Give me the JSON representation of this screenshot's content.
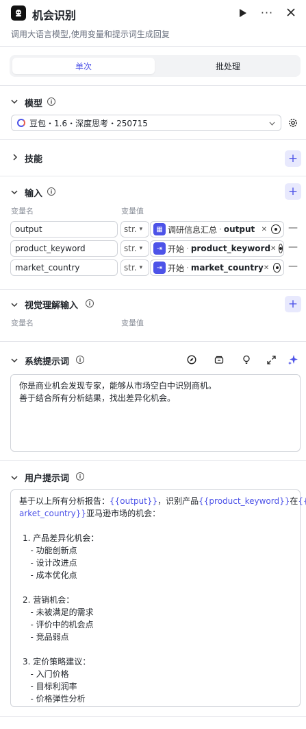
{
  "header": {
    "title": "机会识别",
    "subtitle": "调用大语言模型,使用变量和提示词生成回复",
    "run_icon": "play-icon",
    "more_icon": "more-icon",
    "close_icon": "close-icon"
  },
  "tabs": {
    "single": "单次",
    "batch": "批处理"
  },
  "model": {
    "section_label": "模型",
    "value": "豆包・1.6・深度思考・250715"
  },
  "skills": {
    "section_label": "技能"
  },
  "inputs": {
    "section_label": "输入",
    "col_name": "变量名",
    "col_value": "变量值",
    "rows": [
      {
        "name": "output",
        "type": "str.",
        "node": "调研信息汇总",
        "var": "output"
      },
      {
        "name": "product_keyword",
        "type": "str.",
        "node": "开始",
        "var": "product_keyword"
      },
      {
        "name": "market_country",
        "type": "str.",
        "node": "开始",
        "var": "market_country"
      }
    ]
  },
  "visual": {
    "section_label": "视觉理解输入",
    "col_name": "变量名",
    "col_value": "变量值"
  },
  "system_prompt": {
    "section_label": "系统提示词",
    "line1": "你是商业机会发现专家，能够从市场空白中识别商机。",
    "line2": "善于结合所有分析结果，找出差异化机会。"
  },
  "user_prompt": {
    "section_label": "用户提示词",
    "l1a": "基于以上所有分析报告：",
    "l1b": "{{output}}",
    "l1c": "，识别产品",
    "l1d": "{{product_keyword}}",
    "l1e": "在",
    "l1f": "{{m",
    "l2a": "arket_country}}",
    "l2b": "亚马逊市场的机会：",
    "body": "1. 产品差异化机会：\n   - 功能创新点\n   - 设计改进点\n   - 成本优化点\n\n2. 营销机会：\n   - 未被满足的需求\n   - 评价中的机会点\n   - 竞品弱点\n\n3. 定价策略建议：\n   - 入门价格\n   - 目标利润率\n   - 价格弹性分析"
  },
  "colors": {
    "accent": "#4d53e8",
    "accent_bg": "#e8e9fd"
  }
}
